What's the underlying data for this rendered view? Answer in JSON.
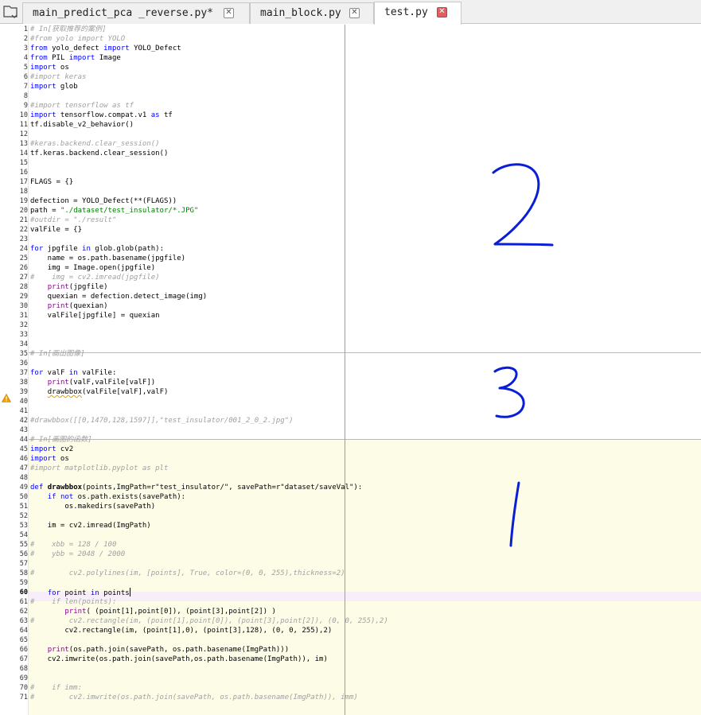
{
  "tabs": [
    {
      "label": "main_predict_pca _reverse.py*",
      "active": false
    },
    {
      "label": "main_block.py",
      "active": false
    },
    {
      "label": "test.py",
      "active": true
    }
  ],
  "tab_close_glyph": "✕",
  "gutter": {
    "warning_line": 39,
    "current_line": 60
  },
  "annotations": [
    "2",
    "3",
    "1"
  ],
  "lines": [
    {
      "n": "1",
      "t": "# In[获取推荐的案例]",
      "c": "c"
    },
    {
      "n": "2",
      "t": "#from yolo import YOLO",
      "c": "c"
    },
    {
      "n": "3",
      "t": "from yolo_defect import YOLO_Defect"
    },
    {
      "n": "4",
      "t": "from PIL import Image"
    },
    {
      "n": "5",
      "t": "import os"
    },
    {
      "n": "6",
      "t": "#import keras",
      "c": "c"
    },
    {
      "n": "7",
      "t": "import glob"
    },
    {
      "n": "8",
      "t": ""
    },
    {
      "n": "9",
      "t": "#import tensorflow as tf",
      "c": "c"
    },
    {
      "n": "10",
      "t": "import tensorflow.compat.v1 as tf"
    },
    {
      "n": "11",
      "t": "tf.disable_v2_behavior()"
    },
    {
      "n": "12",
      "t": ""
    },
    {
      "n": "13",
      "t": "#keras.backend.clear_session()",
      "c": "c"
    },
    {
      "n": "14",
      "t": "tf.keras.backend.clear_session()"
    },
    {
      "n": "15",
      "t": ""
    },
    {
      "n": "16",
      "t": ""
    },
    {
      "n": "17",
      "t": "FLAGS = {}"
    },
    {
      "n": "18",
      "t": ""
    },
    {
      "n": "19",
      "t": "defection = YOLO_Defect(**(FLAGS))"
    },
    {
      "n": "20",
      "t": "path = \"./dataset/test_insulator/*.JPG\""
    },
    {
      "n": "21",
      "t": "#outdir = \"./result\"",
      "c": "c"
    },
    {
      "n": "22",
      "t": "valFile = {}"
    },
    {
      "n": "23",
      "t": ""
    },
    {
      "n": "24",
      "t": "for jpgfile in glob.glob(path):"
    },
    {
      "n": "25",
      "t": "    name = os.path.basename(jpgfile)"
    },
    {
      "n": "26",
      "t": "    img = Image.open(jpgfile)"
    },
    {
      "n": "27",
      "t": "#    img = cv2.imread(jpgfile)",
      "c": "c"
    },
    {
      "n": "28",
      "t": "    print(jpgfile)"
    },
    {
      "n": "29",
      "t": "    quexian = defection.detect_image(img)"
    },
    {
      "n": "30",
      "t": "    print(quexian)"
    },
    {
      "n": "31",
      "t": "    valFile[jpgfile] = quexian"
    },
    {
      "n": "32",
      "t": ""
    },
    {
      "n": "33",
      "t": ""
    },
    {
      "n": "34",
      "t": ""
    },
    {
      "n": "35",
      "t": "# In[画出图像]",
      "c": "c"
    },
    {
      "n": "36",
      "t": ""
    },
    {
      "n": "37",
      "t": "for valF in valFile:"
    },
    {
      "n": "38",
      "t": "    print(valF,valFile[valF])"
    },
    {
      "n": "39",
      "t": "    drawbbox(valFile[valF],valF)"
    },
    {
      "n": "40",
      "t": ""
    },
    {
      "n": "41",
      "t": ""
    },
    {
      "n": "42",
      "t": "#drawbbox([[0,1470,128,1597]],\"test_insulator/001_2_0_2.jpg\")",
      "c": "c"
    },
    {
      "n": "43",
      "t": ""
    },
    {
      "n": "44",
      "t": "# In[画图的函数]",
      "c": "c"
    },
    {
      "n": "45",
      "t": "import cv2"
    },
    {
      "n": "46",
      "t": "import os"
    },
    {
      "n": "47",
      "t": "#import matplotlib.pyplot as plt",
      "c": "c"
    },
    {
      "n": "48",
      "t": ""
    },
    {
      "n": "49",
      "t": "def drawbbox(points,ImgPath=r\"test_insulator/\", savePath=r\"dataset/saveVal\"):"
    },
    {
      "n": "50",
      "t": "    if not os.path.exists(savePath):"
    },
    {
      "n": "51",
      "t": "        os.makedirs(savePath)"
    },
    {
      "n": "52",
      "t": ""
    },
    {
      "n": "53",
      "t": "    im = cv2.imread(ImgPath)"
    },
    {
      "n": "54",
      "t": ""
    },
    {
      "n": "55",
      "t": "#    xbb = 128 / 100",
      "c": "c"
    },
    {
      "n": "56",
      "t": "#    ybb = 2048 / 2000",
      "c": "c"
    },
    {
      "n": "57",
      "t": ""
    },
    {
      "n": "58",
      "t": "#        cv2.polylines(im, [points], True, color=(0, 0, 255),thickness=2)",
      "c": "c"
    },
    {
      "n": "59",
      "t": ""
    },
    {
      "n": "60",
      "t": "    for point in points"
    },
    {
      "n": "61",
      "t": "#    if len(points):",
      "c": "c"
    },
    {
      "n": "62",
      "t": "        print( (point[1],point[0]), (point[3],point[2]) )"
    },
    {
      "n": "63",
      "t": "#        cv2.rectangle(im, (point[1],point[0]), (point[3],point[2]), (0, 0, 255),2)",
      "c": "c"
    },
    {
      "n": "64",
      "t": "        cv2.rectangle(im, (point[1],0), (point[3],128), (0, 0, 255),2)"
    },
    {
      "n": "65",
      "t": ""
    },
    {
      "n": "66",
      "t": "    print(os.path.join(savePath, os.path.basename(ImgPath)))"
    },
    {
      "n": "67",
      "t": "    cv2.imwrite(os.path.join(savePath,os.path.basename(ImgPath)), im)"
    },
    {
      "n": "68",
      "t": ""
    },
    {
      "n": "69",
      "t": ""
    },
    {
      "n": "70",
      "t": "#    if imm:",
      "c": "c"
    },
    {
      "n": "71",
      "t": "#        cv2.imwrite(os.path.join(savePath, os.path.basename(ImgPath)), imm)",
      "c": "c"
    }
  ]
}
